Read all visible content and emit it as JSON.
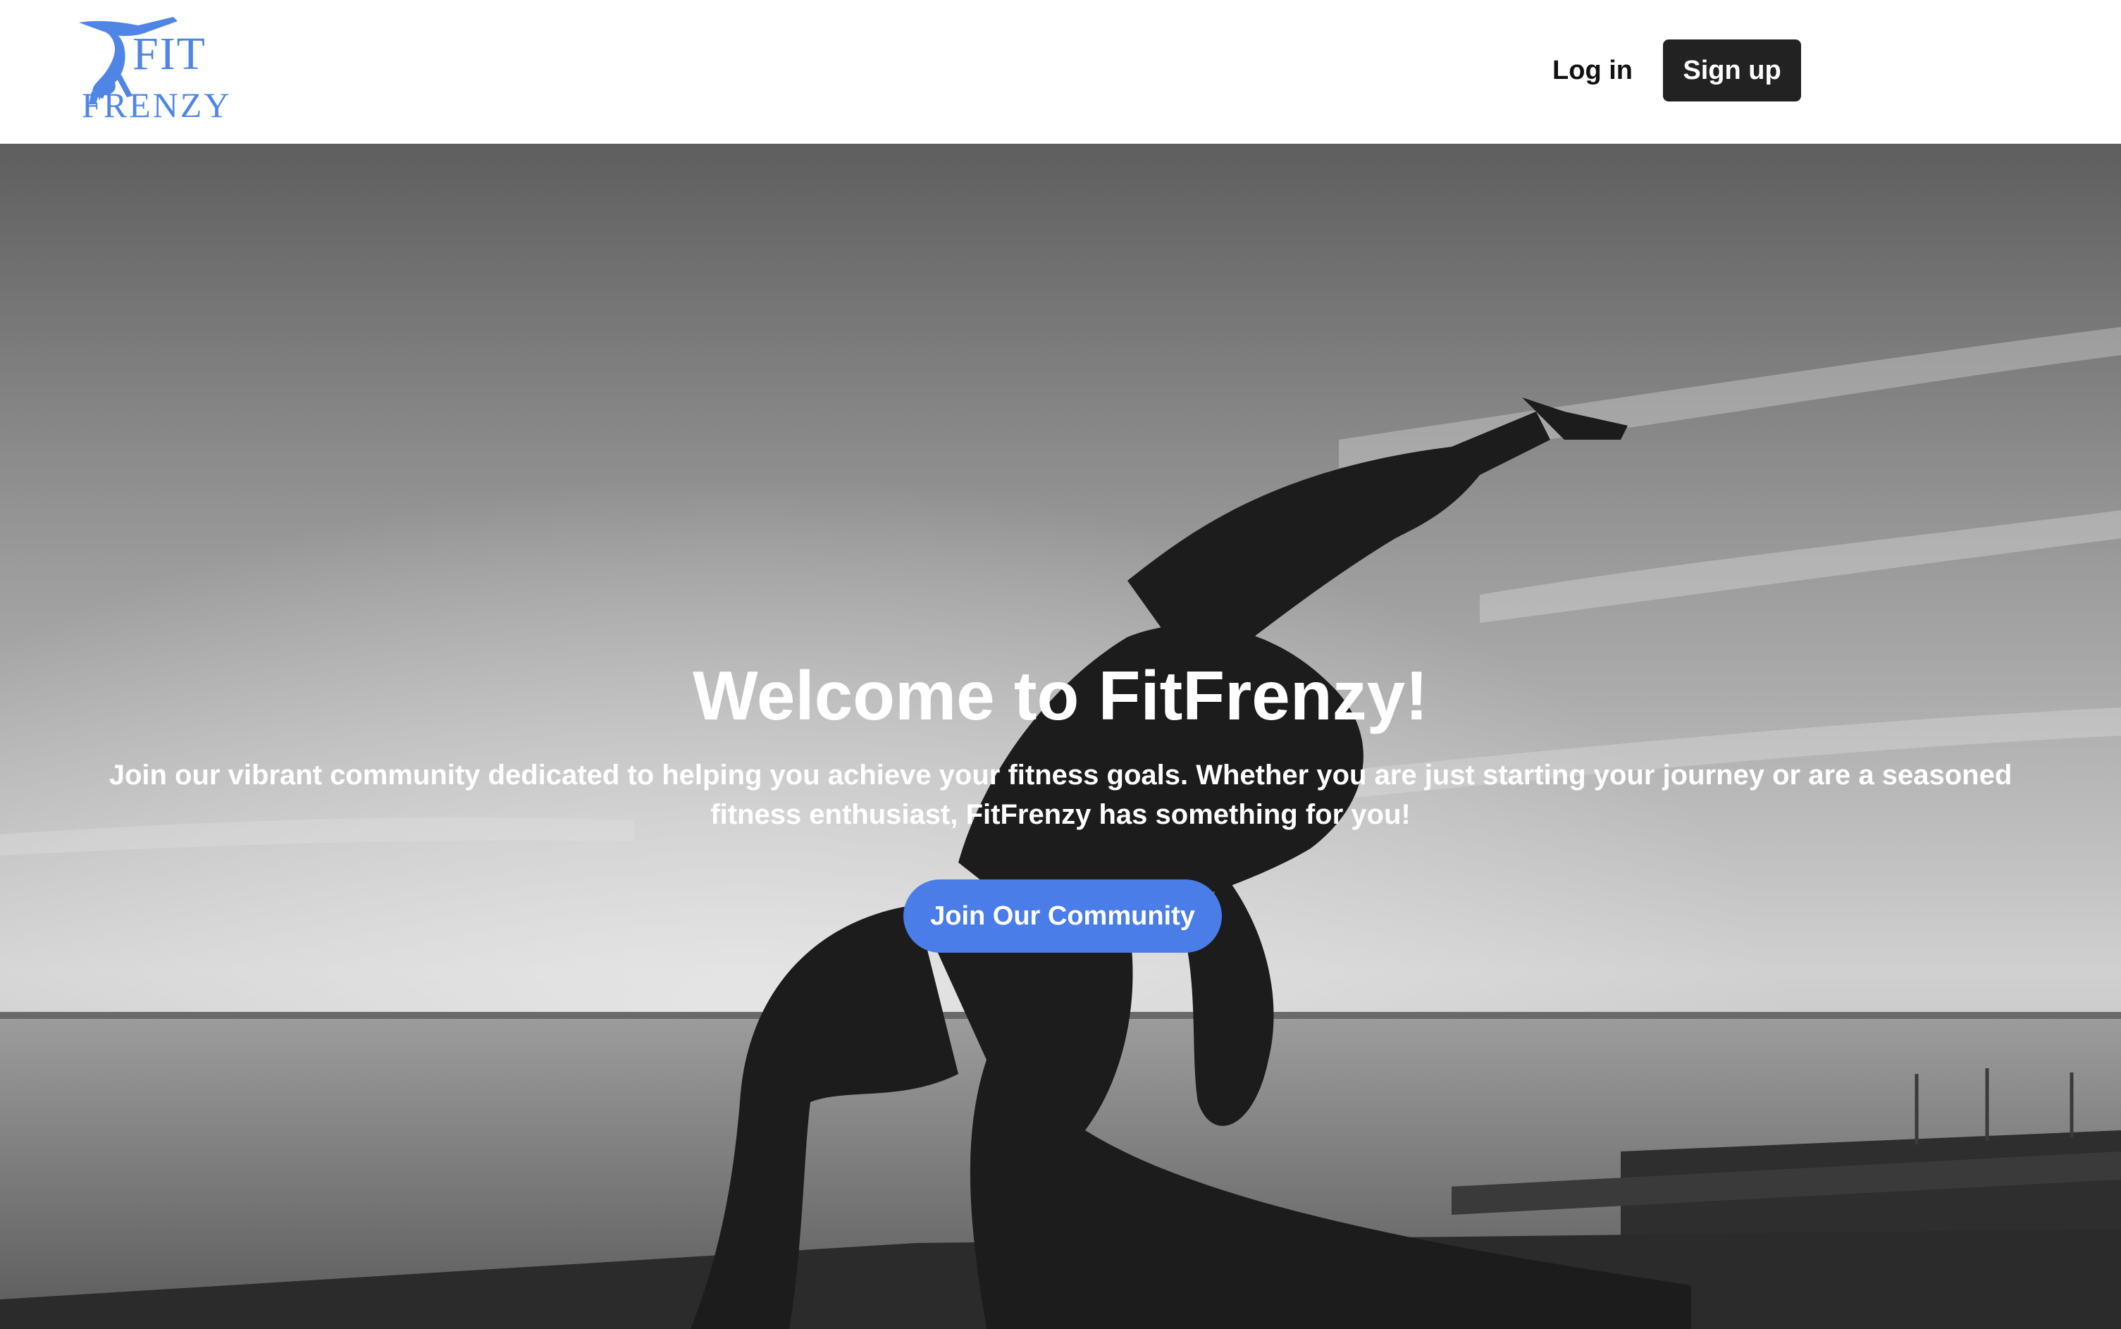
{
  "header": {
    "logo": {
      "line1": "FIT",
      "line2": "FRENZY",
      "icon": "gymnast-silhouette-icon",
      "color": "#4f86e6"
    },
    "login_label": "Log in",
    "signup_label": "Sign up"
  },
  "hero": {
    "background": "black-and-white photo of woman in yoga lunge pose by the sea at dusk",
    "title": "Welcome to FitFrenzy!",
    "description": "Join our vibrant community dedicated to helping you achieve your fitness goals. Whether you are just starting your journey or are a seasoned fitness enthusiast, FitFrenzy has something for you!",
    "cta_label": "Join Our Community",
    "cta_color": "#4a7de8"
  }
}
